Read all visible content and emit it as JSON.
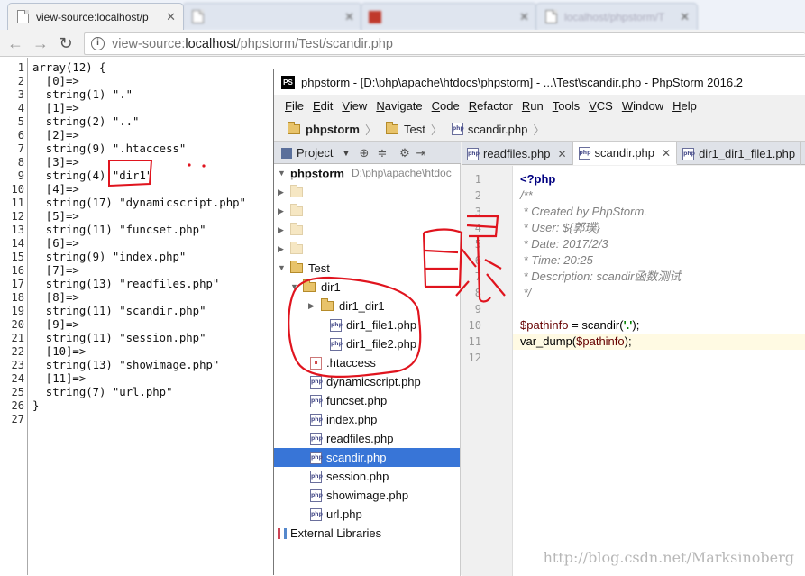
{
  "browser": {
    "tabs": [
      {
        "title": "view-source:localhost/p",
        "active": true
      },
      {
        "title": "",
        "active": false
      },
      {
        "title": "",
        "active": false
      },
      {
        "title": "localhost/phpstorm/T",
        "active": false
      }
    ],
    "url_prefix": "view-source:",
    "url_host": "localhost",
    "url_path": "/phpstorm/Test/scandir.php"
  },
  "source": {
    "line_numbers": [
      "1",
      "2",
      "3",
      "4",
      "5",
      "6",
      "7",
      "8",
      "9",
      "10",
      "11",
      "12",
      "13",
      "14",
      "15",
      "16",
      "17",
      "18",
      "19",
      "20",
      "21",
      "22",
      "23",
      "24",
      "25",
      "26",
      "27"
    ],
    "lines": [
      "array(12) {",
      "  [0]=>",
      "  string(1) \".\"",
      "  [1]=>",
      "  string(2) \"..\"",
      "  [2]=>",
      "  string(9) \".htaccess\"",
      "  [3]=>",
      "  string(4) \"dir1\"",
      "  [4]=>",
      "  string(17) \"dynamicscript.php\"",
      "  [5]=>",
      "  string(11) \"funcset.php\"",
      "  [6]=>",
      "  string(9) \"index.php\"",
      "  [7]=>",
      "  string(13) \"readfiles.php\"",
      "  [8]=>",
      "  string(11) \"scandir.php\"",
      "  [9]=>",
      "  string(11) \"session.php\"",
      "  [10]=>",
      "  string(13) \"showimage.php\"",
      "  [11]=>",
      "  string(7) \"url.php\"",
      "}",
      ""
    ]
  },
  "ide": {
    "logo": "PS",
    "title": "phpstorm - [D:\\php\\apache\\htdocs\\phpstorm] - ...\\Test\\scandir.php - PhpStorm 2016.2",
    "menu": [
      "File",
      "Edit",
      "View",
      "Navigate",
      "Code",
      "Refactor",
      "Run",
      "Tools",
      "VCS",
      "Window",
      "Help"
    ],
    "breadcrumbs": [
      "phpstorm",
      "Test",
      "scandir.php"
    ],
    "project_label": "Project",
    "tree_root": "phpstorm",
    "tree_root_path": "D:\\php\\apache\\htdoc",
    "tree": {
      "test": "Test",
      "dir1": "dir1",
      "dir1_dir1": "dir1_dir1",
      "dir1_file1": "dir1_file1.php",
      "dir1_file2": "dir1_file2.php",
      "htaccess": ".htaccess",
      "files": [
        "dynamicscript.php",
        "funcset.php",
        "index.php",
        "readfiles.php",
        "scandir.php",
        "session.php",
        "showimage.php",
        "url.php"
      ],
      "external": "External Libraries"
    },
    "editor_tabs": [
      "readfiles.php",
      "scandir.php",
      "dir1_dir1_file1.php"
    ],
    "code_line_numbers": [
      "1",
      "2",
      "3",
      "4",
      "5",
      "6",
      "7",
      "8",
      "9",
      "10",
      "11",
      "12"
    ],
    "code": {
      "l1": "<?php",
      "l2": "/**",
      "l3": " * Created by PhpStorm.",
      "l4": " * User: ${郭璞}",
      "l5": " * Date: 2017/2/3",
      "l6": " * Time: 20:25",
      "l7": " * Description: scandir函数测试",
      "l8": " */",
      "l10_var": "$pathinfo",
      "l10_mid": " = scandir(",
      "l10_str": "'.'",
      "l10_end": ");",
      "l11_fn": "var_dump(",
      "l11_var": "$pathinfo",
      "l11_end": ");"
    }
  },
  "watermark": "http://blog.csdn.net/Marksinoberg"
}
